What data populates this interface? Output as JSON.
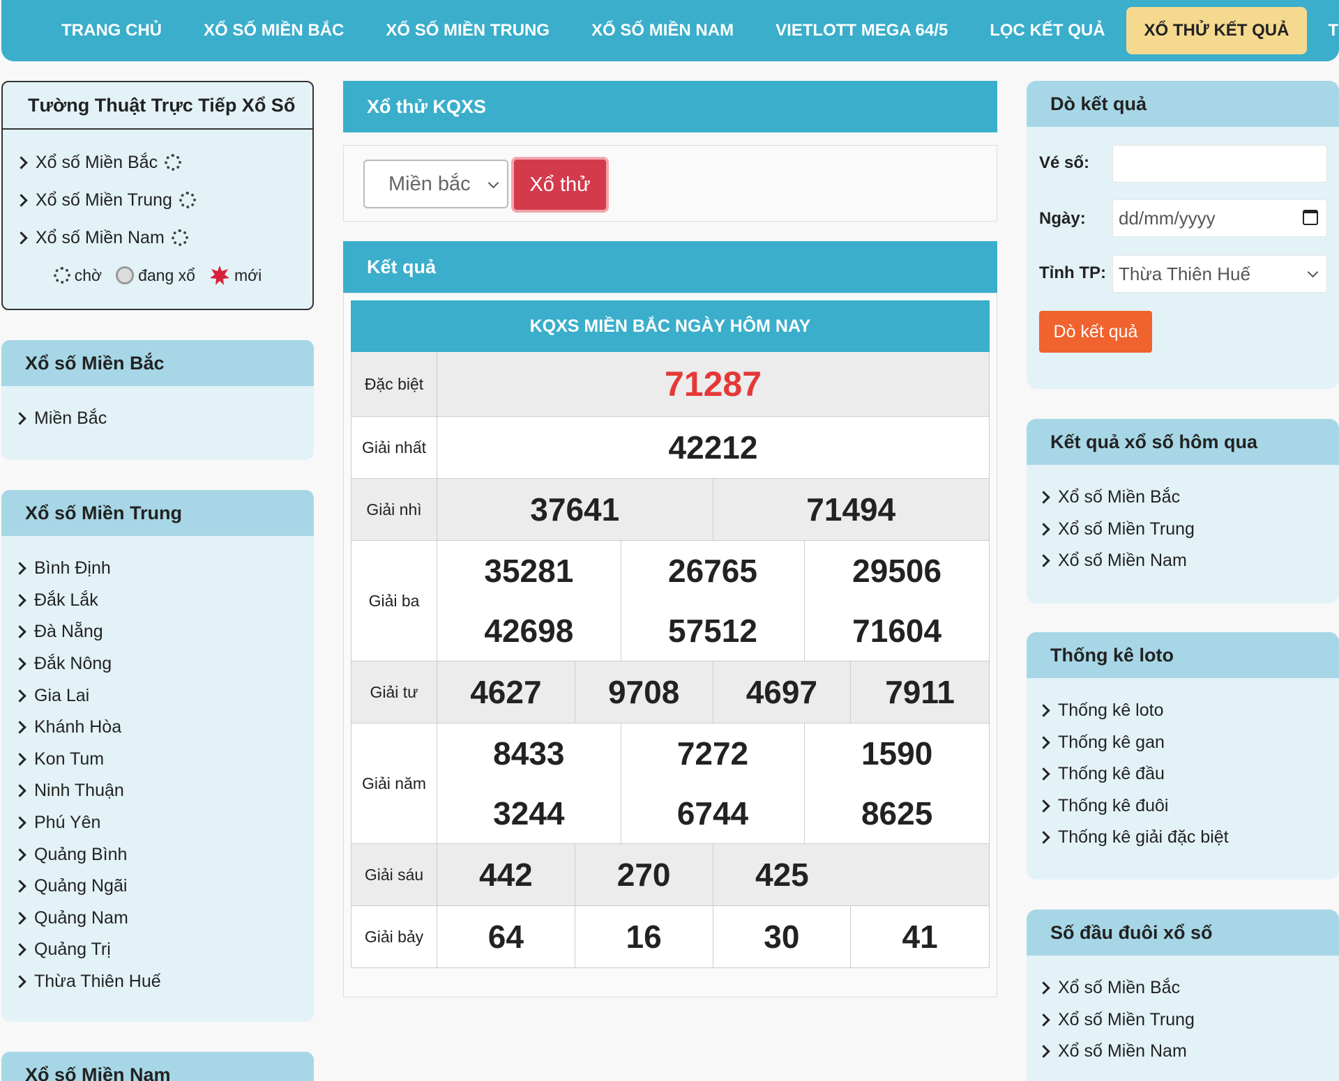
{
  "nav": [
    {
      "label": "TRANG CHỦ",
      "active": false
    },
    {
      "label": "XỔ SỐ MIỀN BẮC",
      "active": false
    },
    {
      "label": "XỔ SỐ MIỀN TRUNG",
      "active": false
    },
    {
      "label": "XỔ SỐ MIỀN NAM",
      "active": false
    },
    {
      "label": "VIETLOTT MEGA 64/5",
      "active": false
    },
    {
      "label": "LỌC KẾT QUẢ",
      "active": false
    },
    {
      "label": "XỔ THỬ KẾT QUẢ",
      "active": true
    },
    {
      "label": "TIN TỨC",
      "active": false
    }
  ],
  "live": {
    "title": "Tường Thuật Trực Tiếp Xổ Số",
    "items": [
      "Xổ số Miền Bắc",
      "Xổ số Miền Trung",
      "Xổ số Miền Nam"
    ],
    "legend": {
      "wait": "chờ",
      "drawing": "đang xổ",
      "new": "mới"
    }
  },
  "left_north": {
    "title": "Xổ số Miền Bắc",
    "items": [
      "Miền Bắc"
    ]
  },
  "left_central": {
    "title": "Xổ số Miền Trung",
    "items": [
      "Bình Định",
      "Đắk Lắk",
      "Đà Nẵng",
      "Đắk Nông",
      "Gia Lai",
      "Khánh Hòa",
      "Kon Tum",
      "Ninh Thuận",
      "Phú Yên",
      "Quảng Bình",
      "Quảng Ngãi",
      "Quảng Nam",
      "Quảng Trị",
      "Thừa Thiên Huế"
    ]
  },
  "left_south": {
    "title": "Xổ số Miền Nam"
  },
  "trial": {
    "title": "Xổ thử KQXS",
    "region_value": "Miền bắc",
    "button": "Xổ thử"
  },
  "result": {
    "section_title": "Kết quả",
    "table_title": "KQXS MIỀN BẮC NGÀY HÔM NAY",
    "prizes": [
      {
        "label": "Đặc biệt",
        "numbers": [
          "71287"
        ]
      },
      {
        "label": "Giải nhất",
        "numbers": [
          "42212"
        ]
      },
      {
        "label": "Giải nhì",
        "numbers": [
          "37641",
          "71494"
        ]
      },
      {
        "label": "Giải ba",
        "numbers": [
          "35281",
          "26765",
          "29506",
          "42698",
          "57512",
          "71604"
        ]
      },
      {
        "label": "Giải tư",
        "numbers": [
          "4627",
          "9708",
          "4697",
          "7911"
        ]
      },
      {
        "label": "Giải năm",
        "numbers": [
          "8433",
          "7272",
          "1590",
          "3244",
          "6744",
          "8625"
        ]
      },
      {
        "label": "Giải sáu",
        "numbers": [
          "442",
          "270",
          "425"
        ]
      },
      {
        "label": "Giải bảy",
        "numbers": [
          "64",
          "16",
          "30",
          "41"
        ]
      }
    ]
  },
  "check": {
    "title": "Dò kết quả",
    "ticket_label": "Vé số:",
    "ticket_value": "",
    "date_label": "Ngày:",
    "date_placeholder": "dd/mm/yyyy",
    "province_label": "Tỉnh TP:",
    "province_value": "Thừa Thiên Huế",
    "button": "Dò kết quả"
  },
  "yesterday": {
    "title": "Kết quả xổ số hôm qua",
    "items": [
      "Xổ số Miền Bắc",
      "Xổ số Miền Trung",
      "Xổ số Miền Nam"
    ]
  },
  "loto_stats": {
    "title": "Thống kê loto",
    "items": [
      "Thống kê loto",
      "Thống kê gan",
      "Thống kê đầu",
      "Thống kê đuôi",
      "Thống kê giải đặc biệt"
    ]
  },
  "head_tail": {
    "title": "Số đầu đuôi xổ số",
    "items": [
      "Xổ số Miền Bắc",
      "Xổ số Miền Trung",
      "Xổ số Miền Nam"
    ]
  },
  "colors": {
    "primary": "#3aaecb",
    "light": "#a7d7e6",
    "panel": "#e3f2f7",
    "accent": "#f5d98f",
    "special": "#e53838",
    "red_button": "#d33a4b",
    "orange_button": "#f0622e"
  }
}
